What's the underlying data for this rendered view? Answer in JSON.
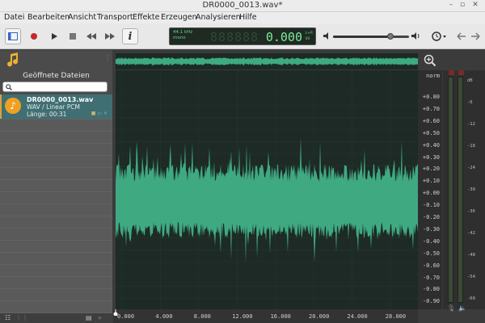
{
  "window": {
    "title": "DR0000_0013.wav*",
    "controls": {
      "minimize": "–",
      "maximize": "▫",
      "close": "✕"
    }
  },
  "menu": [
    "Datei",
    "Bearbeiten",
    "Ansicht",
    "Transport",
    "Effekte",
    "Erzeugen",
    "Analysieren",
    "Hilfe"
  ],
  "toolbar": {
    "lcd": {
      "rate": "44.1 kHz",
      "channels": "mono",
      "time": "0.000",
      "mini_top": "L+R",
      "mini_bottom": "00"
    },
    "volume_level": 0.75
  },
  "sidebar": {
    "header": "Geöffnete Dateien",
    "search_placeholder": "",
    "files": [
      {
        "name": "DR0000_0013.wav",
        "type": "WAV / Linear PCM",
        "length": "Länge: 00:31"
      }
    ]
  },
  "ruler": {
    "top": "norm",
    "labels": [
      "+0.80",
      "+0.70",
      "+0.60",
      "+0.50",
      "+0.40",
      "+0.30",
      "+0.20",
      "+0.10",
      "+0.00",
      "-0.10",
      "-0.20",
      "-0.30",
      "-0.40",
      "-0.50",
      "-0.60",
      "-0.70",
      "-0.80",
      "-0.90"
    ]
  },
  "timeline": {
    "labels": [
      "0.000",
      "4.000",
      "8.000",
      "12.000",
      "16.000",
      "20.000",
      "24.000",
      "28.000"
    ]
  },
  "meters": {
    "scale": [
      "dB",
      "-6",
      "-12",
      "-18",
      "-24",
      "-30",
      "-36",
      "-42",
      "-48",
      "-54",
      "-60"
    ]
  },
  "colors": {
    "wave": "#3fa982",
    "wave_bg": "#1d2a25",
    "accent": "#e0a030",
    "lcd_text": "#7fe89a"
  }
}
